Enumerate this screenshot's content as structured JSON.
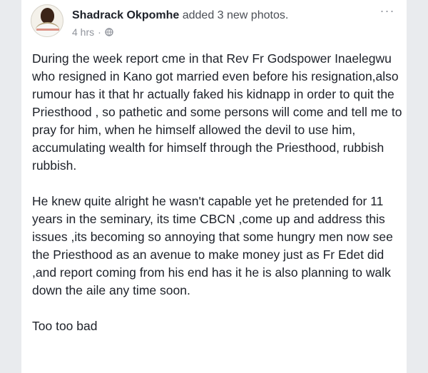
{
  "post": {
    "author_name": "Shadrack Okpomhe",
    "action_text": " added 3 new photos.",
    "timestamp": "4 hrs",
    "separator": "·",
    "privacy_icon": "globe-icon",
    "more_label": "···",
    "paragraphs": [
      "During the week report cme in that Rev Fr Godspower Inaelegwu who resigned in Kano got married even before his resignation,also rumour has it that hr actually faked his kidnapp in order to quit the Priesthood , so pathetic and some persons will come and tell me to pray for him, when he himself allowed the devil to use him, accumulating wealth for himself through the Priesthood, rubbish rubbish.",
      "He knew quite alright he wasn't capable yet he pretended for 11 years in the seminary, its time CBCN ,come up and address this issues ,its becoming so annoying that some hungry men now see the Priesthood as an avenue to make money just as Fr Edet did ,and report coming from his end has it he is also planning to walk down the aile any time soon.",
      "Too too bad"
    ]
  },
  "colors": {
    "page_background": "#e9ebee",
    "card_background": "#ffffff",
    "name_text": "#1d2129",
    "meta_text": "#90949c"
  }
}
